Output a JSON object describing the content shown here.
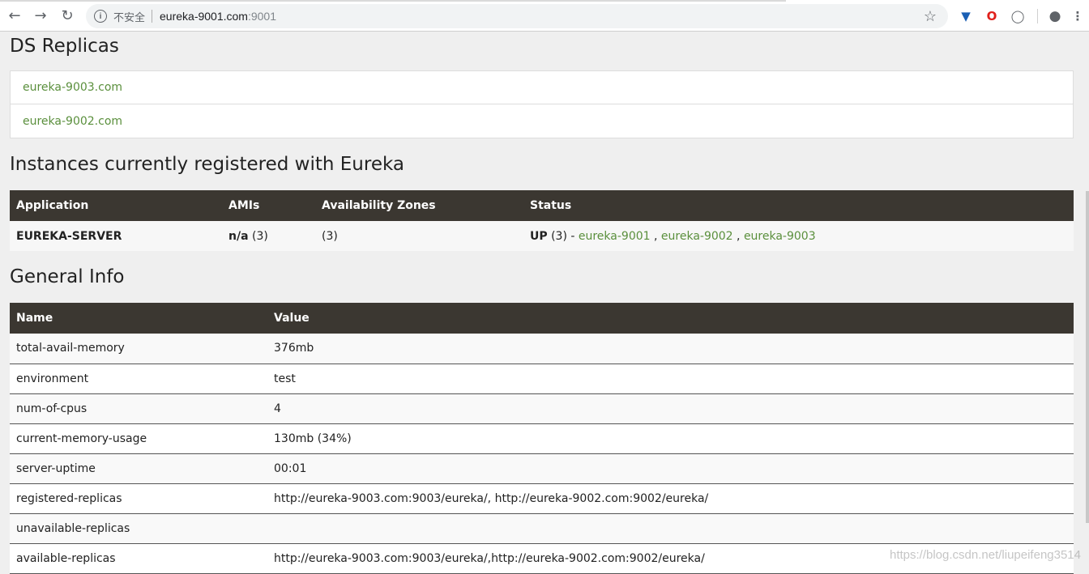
{
  "browser": {
    "security_label": "不安全",
    "url_host": "eureka-9001.com",
    "url_port": ":9001"
  },
  "replicas": {
    "title": "DS Replicas",
    "items": [
      "eureka-9003.com",
      "eureka-9002.com"
    ]
  },
  "instances": {
    "title": "Instances currently registered with Eureka",
    "columns": [
      "Application",
      "AMIs",
      "Availability Zones",
      "Status"
    ],
    "row": {
      "application": "EUREKA-SERVER",
      "amis_bold": "n/a",
      "amis_count": " (3)",
      "zones": "(3)",
      "status_bold": "UP",
      "status_count": " (3) - ",
      "links": [
        "eureka-9001",
        "eureka-9002",
        "eureka-9003"
      ],
      "sep": " , "
    }
  },
  "general": {
    "title": "General Info",
    "columns": [
      "Name",
      "Value"
    ],
    "rows": [
      {
        "name": "total-avail-memory",
        "value": "376mb"
      },
      {
        "name": "environment",
        "value": "test"
      },
      {
        "name": "num-of-cpus",
        "value": "4"
      },
      {
        "name": "current-memory-usage",
        "value": "130mb (34%)"
      },
      {
        "name": "server-uptime",
        "value": "00:01"
      },
      {
        "name": "registered-replicas",
        "value": "http://eureka-9003.com:9003/eureka/, http://eureka-9002.com:9002/eureka/"
      },
      {
        "name": "unavailable-replicas",
        "value": ""
      },
      {
        "name": "available-replicas",
        "value": "http://eureka-9003.com:9003/eureka/,http://eureka-9002.com:9002/eureka/"
      }
    ]
  },
  "watermark": "https://blog.csdn.net/liupeifeng3514"
}
